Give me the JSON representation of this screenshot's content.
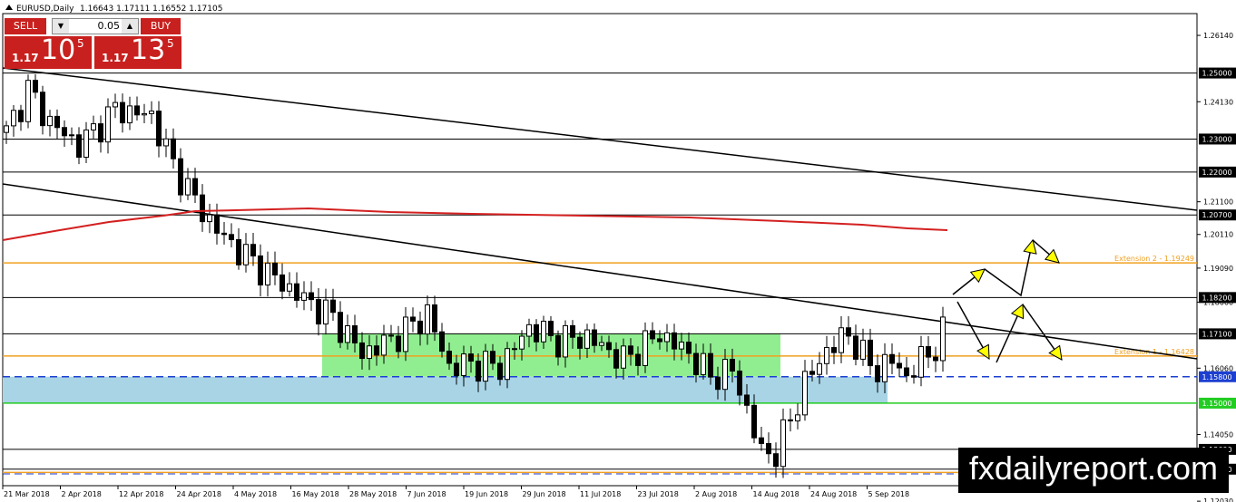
{
  "header": {
    "symbol": "EURUSD,Daily",
    "ohlc": "1.16643 1.17111 1.16552 1.17105"
  },
  "trade_panel": {
    "sell_label": "SELL",
    "buy_label": "BUY",
    "lot_value": "0.05",
    "sell_small": "1.17",
    "sell_big": "10",
    "sell_sup": "5",
    "buy_small": "1.17",
    "buy_big": "13",
    "buy_sup": "5"
  },
  "watermark": "fxdailyreport.com",
  "chart_data": {
    "type": "candlestick",
    "ylim": [
      1.125,
      1.268
    ],
    "price_ticks": [
      "1.26140",
      "1.24130",
      "1.21100",
      "1.20110",
      "1.19090",
      "1.18060",
      "1.16060",
      "1.14050",
      "1.13040",
      "1.12030"
    ],
    "level_lines": [
      {
        "label": "1.25000",
        "value": 1.25,
        "color": "#000000"
      },
      {
        "label": "1.23000",
        "value": 1.23,
        "color": "#000000"
      },
      {
        "label": "1.22000",
        "value": 1.22,
        "color": "#000000"
      },
      {
        "label": "1.20700",
        "value": 1.207,
        "color": "#000000"
      },
      {
        "label": "1.18200",
        "value": 1.182,
        "color": "#000000"
      },
      {
        "label": "1.17100",
        "value": 1.171,
        "color": "#000000"
      },
      {
        "label": "1.15800",
        "value": 1.158,
        "color": "#1c3fd1",
        "dashed": true
      },
      {
        "label": "1.15000",
        "value": 1.15,
        "color": "#22cc22"
      },
      {
        "label": "1.13600",
        "value": 1.136,
        "color": "#000000"
      },
      {
        "label": "1.13000",
        "value": 1.13,
        "color": "#000000"
      }
    ],
    "orange_lines": [
      {
        "label": "Extension 2 - 1.19249",
        "value": 1.19249
      },
      {
        "label": "Extension 1 - 1.16428",
        "value": 1.16428
      },
      {
        "label": "Low - 1.1300",
        "value": 1.129
      }
    ],
    "date_labels": [
      "21 Mar 2018",
      "2 Apr 2018",
      "12 Apr 2018",
      "24 Apr 2018",
      "4 May 2018",
      "16 May 2018",
      "28 May 2018",
      "7 Jun 2018",
      "19 Jun 2018",
      "29 Jun 2018",
      "11 Jul 2018",
      "23 Jul 2018",
      "2 Aug 2018",
      "14 Aug 2018",
      "24 Aug 2018",
      "5 Sep 2018"
    ],
    "colors": {
      "bull": "#ffffff",
      "bear": "#000000",
      "ma": "#d42020",
      "green_zone": "#90ee90",
      "blue_zone": "#a8d4e6",
      "arrows": "#ffff00"
    }
  }
}
